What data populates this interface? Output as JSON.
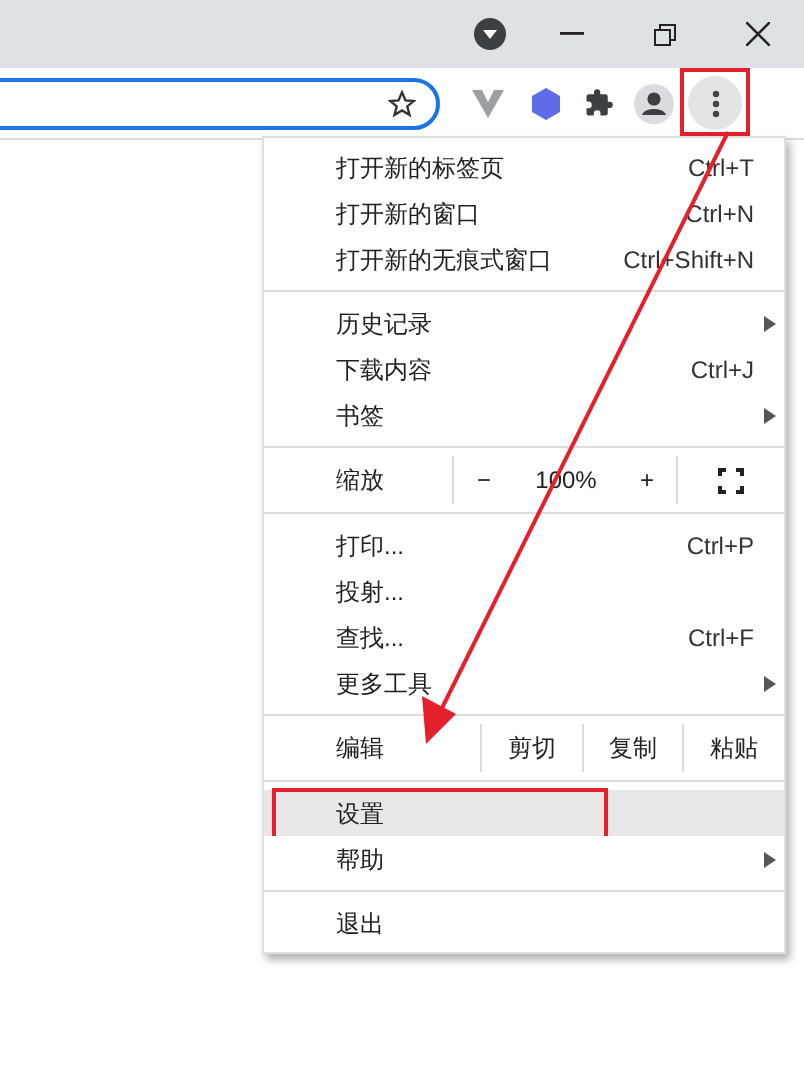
{
  "toolbar": {
    "menu_button": {
      "annotated": true
    }
  },
  "menu": {
    "items": [
      {
        "kind": "item",
        "label": "打开新的标签页",
        "shortcut": "Ctrl+T",
        "submenu": false,
        "highlighted": false,
        "annotated": false
      },
      {
        "kind": "item",
        "label": "打开新的窗口",
        "shortcut": "Ctrl+N",
        "submenu": false,
        "highlighted": false,
        "annotated": false
      },
      {
        "kind": "item",
        "label": "打开新的无痕式窗口",
        "shortcut": "Ctrl+Shift+N",
        "submenu": false,
        "highlighted": false,
        "annotated": false
      },
      {
        "kind": "separator"
      },
      {
        "kind": "item",
        "label": "历史记录",
        "submenu": true,
        "highlighted": false,
        "annotated": false
      },
      {
        "kind": "item",
        "label": "下载内容",
        "shortcut": "Ctrl+J",
        "submenu": false,
        "highlighted": false,
        "annotated": false
      },
      {
        "kind": "item",
        "label": "书签",
        "submenu": true,
        "highlighted": false,
        "annotated": false
      },
      {
        "kind": "separator"
      },
      {
        "kind": "zoom",
        "label": "缩放",
        "minus": "−",
        "value": "100%",
        "plus": "+"
      },
      {
        "kind": "separator"
      },
      {
        "kind": "item",
        "label": "打印...",
        "shortcut": "Ctrl+P",
        "submenu": false,
        "highlighted": false,
        "annotated": false
      },
      {
        "kind": "item",
        "label": "投射...",
        "submenu": false,
        "highlighted": false,
        "annotated": false
      },
      {
        "kind": "item",
        "label": "查找...",
        "shortcut": "Ctrl+F",
        "submenu": false,
        "highlighted": false,
        "annotated": false
      },
      {
        "kind": "item",
        "label": "更多工具",
        "submenu": true,
        "highlighted": false,
        "annotated": false
      },
      {
        "kind": "separator"
      },
      {
        "kind": "edit",
        "label": "编辑",
        "buttons": [
          "剪切",
          "复制",
          "粘贴"
        ]
      },
      {
        "kind": "separator"
      },
      {
        "kind": "item",
        "label": "设置",
        "submenu": false,
        "highlighted": true,
        "annotated": true
      },
      {
        "kind": "item",
        "label": "帮助",
        "submenu": true,
        "highlighted": false,
        "annotated": false
      },
      {
        "kind": "separator"
      },
      {
        "kind": "item",
        "label": "退出",
        "submenu": false,
        "highlighted": false,
        "annotated": false
      }
    ]
  }
}
